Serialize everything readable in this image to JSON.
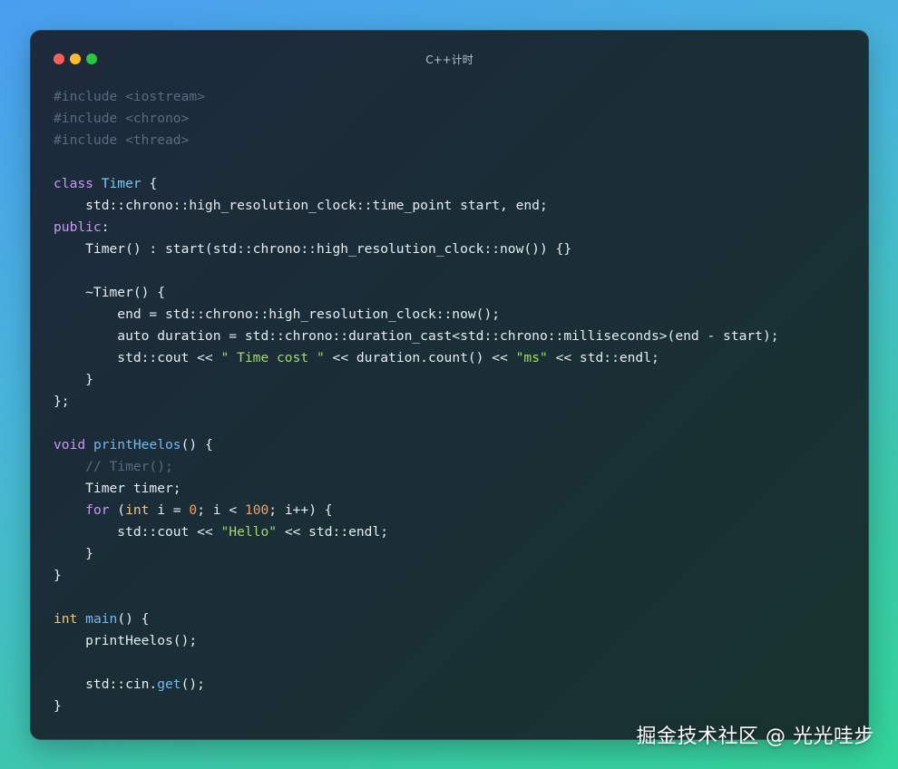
{
  "window": {
    "title": "C++计时",
    "controls": [
      "close",
      "minimize",
      "maximize"
    ]
  },
  "code_lines": [
    [
      {
        "c": "c",
        "t": "#include <iostream>"
      }
    ],
    [
      {
        "c": "c",
        "t": "#include <chrono>"
      }
    ],
    [
      {
        "c": "c",
        "t": "#include <thread>"
      }
    ],
    [],
    [
      {
        "c": "k",
        "t": "class "
      },
      {
        "c": "t",
        "t": "Timer"
      },
      {
        "c": "p",
        "t": " {"
      }
    ],
    [
      {
        "c": "p",
        "t": "    std::chrono::high_resolution_clock::time_point start, end;"
      }
    ],
    [
      {
        "c": "k",
        "t": "public"
      },
      {
        "c": "p",
        "t": ":"
      }
    ],
    [
      {
        "c": "p",
        "t": "    Timer() : start(std::chrono::high_resolution_clock::now()) {}"
      }
    ],
    [],
    [
      {
        "c": "p",
        "t": "    ~Timer() {"
      }
    ],
    [
      {
        "c": "p",
        "t": "        end = std::chrono::high_resolution_clock::now();"
      }
    ],
    [
      {
        "c": "p",
        "t": "        auto duration = std::chrono::duration_cast<std::chrono::milliseconds>(end - start);"
      }
    ],
    [
      {
        "c": "p",
        "t": "        std::cout << "
      },
      {
        "c": "s",
        "t": "\" Time cost \""
      },
      {
        "c": "p",
        "t": " << duration.count() << "
      },
      {
        "c": "s",
        "t": "\"ms\""
      },
      {
        "c": "p",
        "t": " << std::endl;"
      }
    ],
    [
      {
        "c": "p",
        "t": "    }"
      }
    ],
    [
      {
        "c": "p",
        "t": "};"
      }
    ],
    [],
    [
      {
        "c": "k",
        "t": "void "
      },
      {
        "c": "f",
        "t": "printHeelos"
      },
      {
        "c": "p",
        "t": "() {"
      }
    ],
    [
      {
        "c": "c",
        "t": "    // Timer();"
      }
    ],
    [
      {
        "c": "p",
        "t": "    Timer timer;"
      }
    ],
    [
      {
        "c": "p",
        "t": "    "
      },
      {
        "c": "k",
        "t": "for"
      },
      {
        "c": "p",
        "t": " ("
      },
      {
        "c": "y",
        "t": "int"
      },
      {
        "c": "p",
        "t": " i = "
      },
      {
        "c": "n",
        "t": "0"
      },
      {
        "c": "p",
        "t": "; i < "
      },
      {
        "c": "n",
        "t": "100"
      },
      {
        "c": "p",
        "t": "; i++) {"
      }
    ],
    [
      {
        "c": "p",
        "t": "        std::cout << "
      },
      {
        "c": "s",
        "t": "\"Hello\""
      },
      {
        "c": "p",
        "t": " << std::endl;"
      }
    ],
    [
      {
        "c": "p",
        "t": "    }"
      }
    ],
    [
      {
        "c": "p",
        "t": "}"
      }
    ],
    [],
    [
      {
        "c": "y",
        "t": "int "
      },
      {
        "c": "f",
        "t": "main"
      },
      {
        "c": "p",
        "t": "() {"
      }
    ],
    [
      {
        "c": "p",
        "t": "    printHeelos();"
      }
    ],
    [],
    [
      {
        "c": "p",
        "t": "    std::cin."
      },
      {
        "c": "f",
        "t": "get"
      },
      {
        "c": "p",
        "t": "();"
      }
    ],
    [
      {
        "c": "p",
        "t": "}"
      }
    ]
  ],
  "watermark": "掘金技术社区 @ 光光哇步",
  "colors": {
    "comment": "#5a6b80",
    "keyword": "#c79af0",
    "type": "#7ec7f0",
    "function": "#74b9ee",
    "string": "#a6d86e",
    "number": "#f0a06a",
    "primitive": "#f0c674",
    "plain": "#e6edf3"
  }
}
